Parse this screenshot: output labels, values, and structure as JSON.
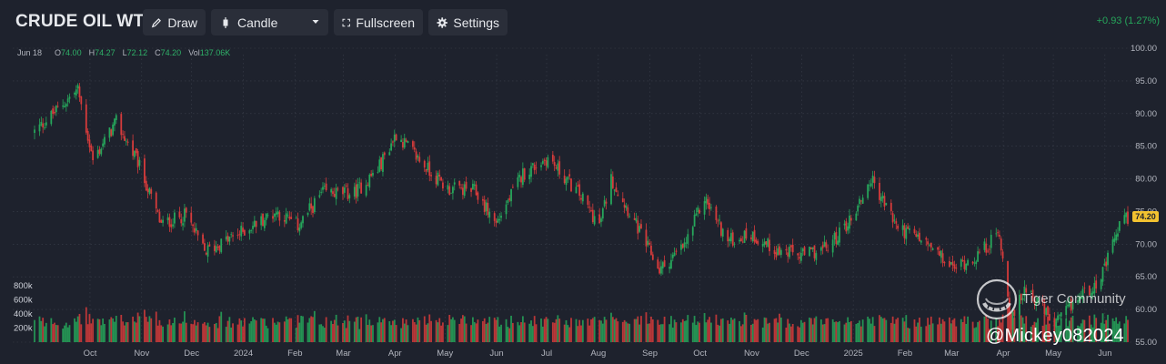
{
  "header": {
    "title": "CRUDE OIL WTI",
    "draw_label": "Draw",
    "chart_type_label": "Candle",
    "fullscreen_label": "Fullscreen",
    "settings_label": "Settings",
    "change": "+0.93 (1.27%)"
  },
  "ohlc": {
    "date": "Jun 18",
    "o_label": "O",
    "o": "74.00",
    "h_label": "H",
    "h": "74.27",
    "l_label": "L",
    "l": "72.12",
    "c_label": "C",
    "c": "74.20",
    "vol_label": "Vol",
    "vol": "137.06K"
  },
  "last_price": "74.20",
  "watermark": {
    "brand": "Tiger Community",
    "user": "@Mickey082024"
  },
  "colors": {
    "background": "#1e222d",
    "up": "#26a65b",
    "down": "#d63b3b",
    "price_tag": "#f2c230"
  },
  "chart_data": {
    "type": "candlestick",
    "price_axis_ticks": [
      "100.00",
      "95.00",
      "90.00",
      "85.00",
      "80.00",
      "75.00",
      "70.00",
      "65.00",
      "60.00",
      "55.00"
    ],
    "price_range": [
      55,
      100
    ],
    "volume_axis_ticks": [
      "800k",
      "600k",
      "400k",
      "200k"
    ],
    "volume_range": [
      0,
      1000000
    ],
    "x_ticks": [
      "Oct",
      "Nov",
      "Dec",
      "2024",
      "Feb",
      "Mar",
      "Apr",
      "May",
      "Jun",
      "Jul",
      "Aug",
      "Sep",
      "Oct",
      "Nov",
      "Dec",
      "2025",
      "Feb",
      "Mar",
      "Apr",
      "May",
      "Jun"
    ],
    "period": {
      "start": "2023-09-01",
      "end": "2025-06-18"
    },
    "close_anchors": [
      {
        "date": "2023-09-01",
        "close": 87.2
      },
      {
        "date": "2023-09-15",
        "close": 90.7
      },
      {
        "date": "2023-09-27",
        "close": 93.7
      },
      {
        "date": "2023-10-06",
        "close": 82.8
      },
      {
        "date": "2023-10-20",
        "close": 88.7
      },
      {
        "date": "2023-11-02",
        "close": 82.5
      },
      {
        "date": "2023-11-16",
        "close": 73.0
      },
      {
        "date": "2023-12-01",
        "close": 74.5
      },
      {
        "date": "2023-12-12",
        "close": 68.8
      },
      {
        "date": "2024-01-01",
        "close": 71.5
      },
      {
        "date": "2024-01-24",
        "close": 75.0
      },
      {
        "date": "2024-02-06",
        "close": 72.8
      },
      {
        "date": "2024-02-21",
        "close": 77.9
      },
      {
        "date": "2024-03-11",
        "close": 77.8
      },
      {
        "date": "2024-03-25",
        "close": 81.5
      },
      {
        "date": "2024-04-05",
        "close": 86.9
      },
      {
        "date": "2024-04-22",
        "close": 82.0
      },
      {
        "date": "2024-05-06",
        "close": 78.5
      },
      {
        "date": "2024-05-22",
        "close": 78.2
      },
      {
        "date": "2024-06-04",
        "close": 73.2
      },
      {
        "date": "2024-06-20",
        "close": 80.8
      },
      {
        "date": "2024-07-05",
        "close": 83.2
      },
      {
        "date": "2024-07-24",
        "close": 77.6
      },
      {
        "date": "2024-08-05",
        "close": 72.9
      },
      {
        "date": "2024-08-12",
        "close": 80.0
      },
      {
        "date": "2024-08-23",
        "close": 74.9
      },
      {
        "date": "2024-09-10",
        "close": 66.0
      },
      {
        "date": "2024-09-25",
        "close": 69.7
      },
      {
        "date": "2024-10-07",
        "close": 77.1
      },
      {
        "date": "2024-10-21",
        "close": 70.5
      },
      {
        "date": "2024-11-04",
        "close": 71.5
      },
      {
        "date": "2024-11-20",
        "close": 68.9
      },
      {
        "date": "2024-12-05",
        "close": 68.3
      },
      {
        "date": "2024-12-20",
        "close": 69.5
      },
      {
        "date": "2025-01-03",
        "close": 73.9
      },
      {
        "date": "2025-01-15",
        "close": 80.0
      },
      {
        "date": "2025-01-31",
        "close": 72.5
      },
      {
        "date": "2025-02-14",
        "close": 70.7
      },
      {
        "date": "2025-03-05",
        "close": 66.3
      },
      {
        "date": "2025-03-20",
        "close": 68.3
      },
      {
        "date": "2025-04-02",
        "close": 71.7
      },
      {
        "date": "2025-04-09",
        "close": 58.0
      },
      {
        "date": "2025-04-18",
        "close": 63.7
      },
      {
        "date": "2025-05-05",
        "close": 57.5
      },
      {
        "date": "2025-05-20",
        "close": 62.0
      },
      {
        "date": "2025-06-02",
        "close": 64.7
      },
      {
        "date": "2025-06-13",
        "close": 72.9
      },
      {
        "date": "2025-06-18",
        "close": 74.2
      }
    ]
  }
}
